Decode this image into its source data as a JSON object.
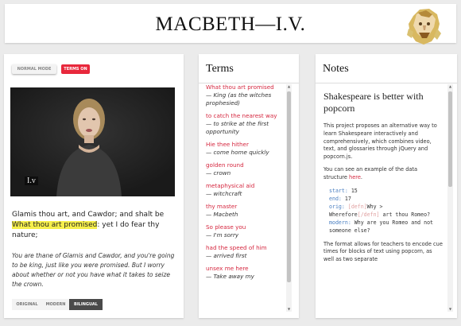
{
  "header": {
    "title": "MACBETH—I.V."
  },
  "video_panel": {
    "normal_mode_label": "Normal Mode",
    "terms_on_label": "Terms On",
    "timestamp": "I.v",
    "line1": "Glamis thou art, and Cawdor; and shalt be",
    "highlight_phrase": "What thou art promised",
    "line2_rest": ": yet I do fear thy",
    "line3": "nature;",
    "gloss": "You are thane of Glamis and Cawdor, and you're going to be king, just like you were promised. But I worry about whether or not you have what it takes to seize the crown.",
    "modes": [
      "Original",
      "Modern",
      "Bilingual"
    ]
  },
  "terms": {
    "title": "Terms",
    "items": [
      {
        "word": "What thou art promised",
        "def": "— King (as the witches prophesied)"
      },
      {
        "word": "to catch the nearest way",
        "def": "— to strike at the first opportunity"
      },
      {
        "word": "Hie thee hither",
        "def": "— come home quickly"
      },
      {
        "word": "golden round",
        "def": "— crown"
      },
      {
        "word": "metaphysical aid",
        "def": "— witchcraft"
      },
      {
        "word": "thy master",
        "def": "— Macbeth"
      },
      {
        "word": "So please you",
        "def": "— I'm sorry"
      },
      {
        "word": "had the speed of him",
        "def": "— arrived first"
      },
      {
        "word": "unsex me here",
        "def": "— Take away my"
      }
    ]
  },
  "notes": {
    "title": "Notes",
    "heading": "Shakespeare is better with popcorn",
    "p1": "This project proposes an alternative way to learn Shakespeare interactively and comprehensively, which combines video, text, and glossaries through jQuery and popcorn.js.",
    "p2_before": "You can see an example of the data structure ",
    "p2_link": "here",
    "p2_after": ".",
    "code": {
      "start_key": "start:",
      "start_val": "15",
      "end_key": "end:",
      "end_val": "17",
      "orig_key": "orig:",
      "orig_tag_open": "[defn]",
      "orig_text1": "Why >",
      "orig_text2": "Wherefore",
      "orig_tag_close": "[/defn]",
      "orig_text3": "art thou Romeo?",
      "modern_key": "modern:",
      "modern_val": "Why are you Romeo and not someone else?"
    },
    "p3": "The format allows for teachers to encode cue times for blocks of text using popcorn, as well as two separate"
  },
  "colors": {
    "accent": "#e8283c",
    "highlight": "#f6ef4b",
    "link": "#d5273f"
  }
}
